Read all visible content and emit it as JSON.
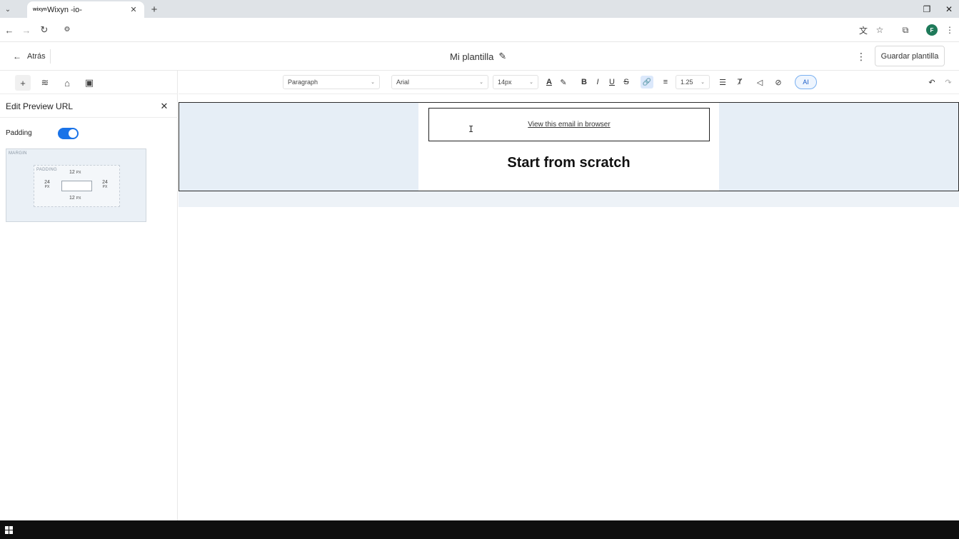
{
  "browser": {
    "tab_title": "Wixyn -io-",
    "favicon_text": "wixyn",
    "tab_close": "✕",
    "new_tab": "+",
    "tab_list": "⌄",
    "back": "←",
    "forward": "→",
    "reload": "↻",
    "site_info": "⚙",
    "translate_icon": "文",
    "bookmark_icon": "☆",
    "extensions_icon": "⧉",
    "profile_initial": "F",
    "menu_icon": "⋮",
    "window_restore": "❐",
    "window_close": "✕"
  },
  "header": {
    "back_arrow": "←",
    "back_label": "Atrás",
    "template_name": "Mi plantilla",
    "edit_icon": "✎",
    "more_icon": "⋮",
    "save_label": "Guardar plantilla"
  },
  "left_panel": {
    "tools": {
      "add": "+",
      "layers": "≋",
      "style": "⌂",
      "save": "▣"
    },
    "title": "Edit Preview URL",
    "close": "✕",
    "padding_label": "Padding",
    "padding_enabled": true,
    "box_model": {
      "margin_label": "MARGIN",
      "padding_label": "PADDING",
      "top": "12",
      "bottom": "12",
      "left": "24",
      "right": "24",
      "unit": "PX"
    }
  },
  "format_toolbar": {
    "block_type": "Paragraph",
    "font_family": "Arial",
    "font_size": "14px",
    "line_height": "1.25",
    "chevron": "⌄",
    "icons": {
      "text_color": "A",
      "highlight": "✎",
      "bold": "B",
      "italic": "I",
      "underline": "U",
      "strikethrough": "S",
      "link": "🔗",
      "align": "≡",
      "list": "☰",
      "clear_format": "Ⱦ",
      "merge_tags": "◁",
      "unlink": "⊘",
      "undo": "↶",
      "redo": "↷"
    },
    "ai_label": "AI"
  },
  "canvas": {
    "preview_link": "View this email in browser",
    "heading": "Start from scratch",
    "cursor": "I"
  },
  "colors": {
    "accent": "#1a73e8",
    "section_bg": "#e6eef6"
  }
}
